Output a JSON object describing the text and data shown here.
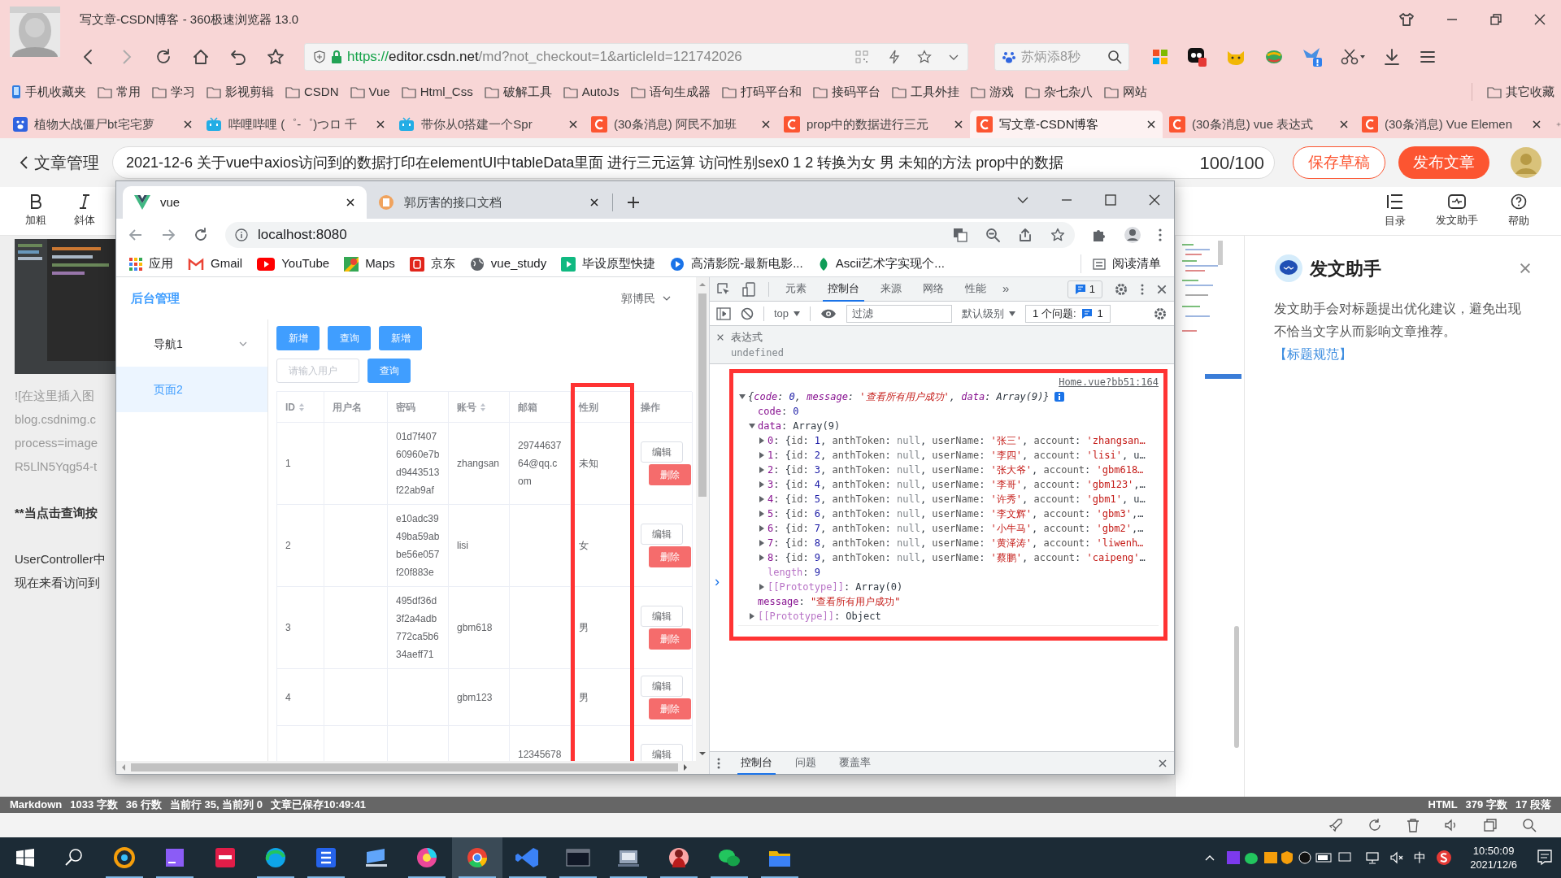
{
  "browser": {
    "title": "写文章-CSDN博客 - 360极速浏览器 13.0",
    "url": {
      "scheme": "https://",
      "host": "editor.csdn.net",
      "path": "/md?not_checkout=1&articleId=121742026"
    },
    "search": "苏炳添8秒",
    "bookmarks": [
      {
        "label": "手机收藏夹",
        "kind": "phone"
      },
      {
        "label": "常用",
        "kind": "folder"
      },
      {
        "label": "学习",
        "kind": "folder"
      },
      {
        "label": "影视剪辑",
        "kind": "folder"
      },
      {
        "label": "CSDN",
        "kind": "folder"
      },
      {
        "label": "Vue",
        "kind": "folder"
      },
      {
        "label": "Html_Css",
        "kind": "folder"
      },
      {
        "label": "破解工具",
        "kind": "folder"
      },
      {
        "label": "AutoJs",
        "kind": "folder"
      },
      {
        "label": "语句生成器",
        "kind": "folder"
      },
      {
        "label": "打码平台和",
        "kind": "folder"
      },
      {
        "label": "接码平台",
        "kind": "folder"
      },
      {
        "label": "工具外挂",
        "kind": "folder"
      },
      {
        "label": "游戏",
        "kind": "folder"
      },
      {
        "label": "杂七杂八",
        "kind": "folder"
      },
      {
        "label": "网站",
        "kind": "folder"
      }
    ],
    "other_bookmarks": "其它收藏",
    "tabs": [
      {
        "label": "植物大战僵尸bt宅宅萝",
        "kind": "baidu",
        "selected": false
      },
      {
        "label": "哔哩哔哩 (゜-゜)つロ 千",
        "kind": "bilibili",
        "selected": false
      },
      {
        "label": "带你从0搭建一个Spr",
        "kind": "bilibili",
        "selected": false
      },
      {
        "label": "(30条消息) 阿民不加班",
        "kind": "csdn",
        "selected": false
      },
      {
        "label": "prop中的数据进行三元",
        "kind": "csdn",
        "selected": false
      },
      {
        "label": "写文章-CSDN博客",
        "kind": "csdn",
        "selected": true
      },
      {
        "label": "(30条消息) vue 表达式",
        "kind": "csdn",
        "selected": false
      },
      {
        "label": "(30条消息) Vue Elemen",
        "kind": "csdn",
        "selected": false
      }
    ]
  },
  "editor": {
    "back": "文章管理",
    "title": "2021-12-6 关于vue中axios访问到的数据打印在elementUI中tableData里面 进行三元运算 访问性别sex0 1 2 转换为女 男 未知的方法  prop中的数据",
    "counter": "100/100",
    "save": "保存草稿",
    "publish": "发布文章",
    "tools_left": [
      {
        "kind": "bold",
        "label": "加粗"
      },
      {
        "kind": "italic",
        "label": "斜体"
      }
    ],
    "tools_right": [
      {
        "kind": "toc",
        "label": "目录"
      },
      {
        "kind": "assistant",
        "label": "发文助手"
      },
      {
        "kind": "help",
        "label": "帮助"
      }
    ],
    "paragraphs": [
      {
        "kind": "image-link",
        "lines": [
          "![在这里插入图",
          "blog.csdnimg.c",
          "process=image",
          "R5LlN5Yqg54-t"
        ]
      },
      {
        "kind": "bold",
        "lines": [
          "**当点击查询按"
        ]
      },
      {
        "kind": "text",
        "lines": [
          "UserController中",
          "现在来看访问到"
        ]
      }
    ]
  },
  "assistant": {
    "title": "发文助手",
    "text": "发文助手会对标题提出优化建议，避免出现不恰当文字从而影响文章推荐。",
    "link": "【标题规范】"
  },
  "status_bar": {
    "left": [
      "Markdown",
      "1033 字数",
      "36 行数",
      "当前行 35, 当前列 0",
      "文章已保存10:49:41"
    ],
    "right": [
      "HTML",
      "379 字数",
      "17 段落"
    ]
  },
  "chrome": {
    "tabs": [
      {
        "label": "vue",
        "kind": "vue",
        "selected": true
      },
      {
        "label": "郭厉害的接口文档",
        "kind": "doc",
        "selected": false
      }
    ],
    "url": "localhost:8080",
    "bookmarks": [
      {
        "label": "应用",
        "kind": "apps"
      },
      {
        "label": "Gmail",
        "kind": "gmail"
      },
      {
        "label": "YouTube",
        "kind": "youtube"
      },
      {
        "label": "Maps",
        "kind": "maps"
      },
      {
        "label": "京东",
        "kind": "jd"
      },
      {
        "label": "vue_study",
        "kind": "globe"
      },
      {
        "label": "毕设原型快捷",
        "kind": "play"
      },
      {
        "label": "高清影院-最新电影...",
        "kind": "movie"
      },
      {
        "label": "Ascii艺术字实现个...",
        "kind": "leaf"
      }
    ],
    "reading_list": "阅读清单"
  },
  "page": {
    "brand": "后台管理",
    "user": "郭博民",
    "nav": [
      {
        "label": "导航1",
        "kind": "group",
        "expanded": false,
        "selected": false
      },
      {
        "label": "页面2",
        "kind": "item",
        "selected": true
      }
    ],
    "buttons": [
      "新增",
      "查询",
      "新增"
    ],
    "search": {
      "placeholder": "请输入用户",
      "button": "查询"
    },
    "table": {
      "columns": [
        {
          "label": "ID",
          "sortable": true
        },
        {
          "label": "用户名",
          "sortable": false
        },
        {
          "label": "密码",
          "sortable": false
        },
        {
          "label": "账号",
          "sortable": true
        },
        {
          "label": "邮箱",
          "sortable": false
        },
        {
          "label": "性别",
          "sortable": false,
          "highlighted": true
        },
        {
          "label": "操作",
          "sortable": false
        }
      ],
      "rows": [
        {
          "id": "1",
          "password": "01d7f40760960e7bd9443513f22ab9af",
          "account": "zhangsan",
          "email": "2974463764@qq.com",
          "gender": "未知",
          "edit": "编辑",
          "delete": "删除"
        },
        {
          "id": "2",
          "password": "e10adc3949ba59abbe56e057f20f883e",
          "account": "lisi",
          "gender": "女",
          "edit": "编辑",
          "delete": "删除"
        },
        {
          "id": "3",
          "password": "495df36d3f2a4adb772ca5b634aeff71",
          "account": "gbm618",
          "gender": "男",
          "edit": "编辑",
          "delete": "删除"
        },
        {
          "id": "4",
          "account": "gbm123",
          "gender": "男",
          "edit": "编辑",
          "delete": "删除"
        },
        {
          "email": "12345678",
          "edit": "编辑"
        }
      ]
    }
  },
  "devtools": {
    "tabs": [
      {
        "label": "元素",
        "selected": false
      },
      {
        "label": "控制台",
        "selected": true
      },
      {
        "label": "来源",
        "selected": false
      },
      {
        "label": "网络",
        "selected": false
      },
      {
        "label": "性能",
        "selected": false
      }
    ],
    "more": "»",
    "badge": "1",
    "context": "top",
    "filter_placeholder": "过滤",
    "level": "默认级别",
    "issues_label": "1 个问题:",
    "issues_count": "1",
    "expression": {
      "label": "表达式",
      "value": "undefined"
    },
    "console": {
      "highlighted": true,
      "source": "Home.vue?bb51:164",
      "prompt": "›",
      "tree": [
        {
          "segs": [
            {
              "kind": "p",
              "text": "{"
            },
            {
              "kind": "k",
              "text": "code"
            },
            {
              "kind": "p",
              "text": ": "
            },
            {
              "kind": "n",
              "text": "0"
            },
            {
              "kind": "p",
              "text": ", "
            },
            {
              "kind": "k",
              "text": "message"
            },
            {
              "kind": "p",
              "text": ": "
            },
            {
              "kind": "s",
              "text": "'查看所有用户成功'"
            },
            {
              "kind": "p",
              "text": ", "
            },
            {
              "kind": "k",
              "text": "data"
            },
            {
              "kind": "p",
              "text": ": Array(9)}"
            }
          ],
          "expanded": true,
          "children": [
            {
              "segs": [
                {
                  "kind": "k",
                  "text": "code"
                },
                {
                  "kind": "p",
                  "text": ": "
                },
                {
                  "kind": "n",
                  "text": "0"
                }
              ]
            },
            {
              "segs": [
                {
                  "kind": "k",
                  "text": "data"
                },
                {
                  "kind": "p",
                  "text": ": Array(9)"
                }
              ],
              "expanded": true,
              "children": [
                {
                  "segs": [
                    {
                      "kind": "k",
                      "text": "0"
                    },
                    {
                      "kind": "p",
                      "text": ": {"
                    },
                    {
                      "kind": "pk",
                      "text": "id"
                    },
                    {
                      "kind": "p",
                      "text": ": "
                    },
                    {
                      "kind": "n",
                      "text": "1"
                    },
                    {
                      "kind": "p",
                      "text": ", "
                    },
                    {
                      "kind": "pk",
                      "text": "anthToken"
                    },
                    {
                      "kind": "p",
                      "text": ": "
                    },
                    {
                      "kind": "nl",
                      "text": "null"
                    },
                    {
                      "kind": "p",
                      "text": ", "
                    },
                    {
                      "kind": "pk",
                      "text": "userName"
                    },
                    {
                      "kind": "p",
                      "text": ": "
                    },
                    {
                      "kind": "s",
                      "text": "'张三'"
                    },
                    {
                      "kind": "p",
                      "text": ", "
                    },
                    {
                      "kind": "pk",
                      "text": "account"
                    },
                    {
                      "kind": "p",
                      "text": ": "
                    },
                    {
                      "kind": "s",
                      "text": "'zhangsan…"
                    }
                  ],
                  "expanded": false
                },
                {
                  "segs": [
                    {
                      "kind": "k",
                      "text": "1"
                    },
                    {
                      "kind": "p",
                      "text": ": {"
                    },
                    {
                      "kind": "pk",
                      "text": "id"
                    },
                    {
                      "kind": "p",
                      "text": ": "
                    },
                    {
                      "kind": "n",
                      "text": "2"
                    },
                    {
                      "kind": "p",
                      "text": ", "
                    },
                    {
                      "kind": "pk",
                      "text": "anthToken"
                    },
                    {
                      "kind": "p",
                      "text": ": "
                    },
                    {
                      "kind": "nl",
                      "text": "null"
                    },
                    {
                      "kind": "p",
                      "text": ", "
                    },
                    {
                      "kind": "pk",
                      "text": "userName"
                    },
                    {
                      "kind": "p",
                      "text": ": "
                    },
                    {
                      "kind": "s",
                      "text": "'李四'"
                    },
                    {
                      "kind": "p",
                      "text": ", "
                    },
                    {
                      "kind": "pk",
                      "text": "account"
                    },
                    {
                      "kind": "p",
                      "text": ": "
                    },
                    {
                      "kind": "s",
                      "text": "'lisi'"
                    },
                    {
                      "kind": "p",
                      "text": ", u…"
                    }
                  ],
                  "expanded": false
                },
                {
                  "segs": [
                    {
                      "kind": "k",
                      "text": "2"
                    },
                    {
                      "kind": "p",
                      "text": ": {"
                    },
                    {
                      "kind": "pk",
                      "text": "id"
                    },
                    {
                      "kind": "p",
                      "text": ": "
                    },
                    {
                      "kind": "n",
                      "text": "3"
                    },
                    {
                      "kind": "p",
                      "text": ", "
                    },
                    {
                      "kind": "pk",
                      "text": "anthToken"
                    },
                    {
                      "kind": "p",
                      "text": ": "
                    },
                    {
                      "kind": "nl",
                      "text": "null"
                    },
                    {
                      "kind": "p",
                      "text": ", "
                    },
                    {
                      "kind": "pk",
                      "text": "userName"
                    },
                    {
                      "kind": "p",
                      "text": ": "
                    },
                    {
                      "kind": "s",
                      "text": "'张大爷'"
                    },
                    {
                      "kind": "p",
                      "text": ", "
                    },
                    {
                      "kind": "pk",
                      "text": "account"
                    },
                    {
                      "kind": "p",
                      "text": ": "
                    },
                    {
                      "kind": "s",
                      "text": "'gbm618…"
                    }
                  ],
                  "expanded": false
                },
                {
                  "segs": [
                    {
                      "kind": "k",
                      "text": "3"
                    },
                    {
                      "kind": "p",
                      "text": ": {"
                    },
                    {
                      "kind": "pk",
                      "text": "id"
                    },
                    {
                      "kind": "p",
                      "text": ": "
                    },
                    {
                      "kind": "n",
                      "text": "4"
                    },
                    {
                      "kind": "p",
                      "text": ", "
                    },
                    {
                      "kind": "pk",
                      "text": "anthToken"
                    },
                    {
                      "kind": "p",
                      "text": ": "
                    },
                    {
                      "kind": "nl",
                      "text": "null"
                    },
                    {
                      "kind": "p",
                      "text": ", "
                    },
                    {
                      "kind": "pk",
                      "text": "userName"
                    },
                    {
                      "kind": "p",
                      "text": ": "
                    },
                    {
                      "kind": "s",
                      "text": "'李哥'"
                    },
                    {
                      "kind": "p",
                      "text": ", "
                    },
                    {
                      "kind": "pk",
                      "text": "account"
                    },
                    {
                      "kind": "p",
                      "text": ": "
                    },
                    {
                      "kind": "s",
                      "text": "'gbm123'"
                    },
                    {
                      "kind": "p",
                      "text": ",…"
                    }
                  ],
                  "expanded": false
                },
                {
                  "segs": [
                    {
                      "kind": "k",
                      "text": "4"
                    },
                    {
                      "kind": "p",
                      "text": ": {"
                    },
                    {
                      "kind": "pk",
                      "text": "id"
                    },
                    {
                      "kind": "p",
                      "text": ": "
                    },
                    {
                      "kind": "n",
                      "text": "5"
                    },
                    {
                      "kind": "p",
                      "text": ", "
                    },
                    {
                      "kind": "pk",
                      "text": "anthToken"
                    },
                    {
                      "kind": "p",
                      "text": ": "
                    },
                    {
                      "kind": "nl",
                      "text": "null"
                    },
                    {
                      "kind": "p",
                      "text": ", "
                    },
                    {
                      "kind": "pk",
                      "text": "userName"
                    },
                    {
                      "kind": "p",
                      "text": ": "
                    },
                    {
                      "kind": "s",
                      "text": "'许秀'"
                    },
                    {
                      "kind": "p",
                      "text": ", "
                    },
                    {
                      "kind": "pk",
                      "text": "account"
                    },
                    {
                      "kind": "p",
                      "text": ": "
                    },
                    {
                      "kind": "s",
                      "text": "'gbm1'"
                    },
                    {
                      "kind": "p",
                      "text": ", u…"
                    }
                  ],
                  "expanded": false
                },
                {
                  "segs": [
                    {
                      "kind": "k",
                      "text": "5"
                    },
                    {
                      "kind": "p",
                      "text": ": {"
                    },
                    {
                      "kind": "pk",
                      "text": "id"
                    },
                    {
                      "kind": "p",
                      "text": ": "
                    },
                    {
                      "kind": "n",
                      "text": "6"
                    },
                    {
                      "kind": "p",
                      "text": ", "
                    },
                    {
                      "kind": "pk",
                      "text": "anthToken"
                    },
                    {
                      "kind": "p",
                      "text": ": "
                    },
                    {
                      "kind": "nl",
                      "text": "null"
                    },
                    {
                      "kind": "p",
                      "text": ", "
                    },
                    {
                      "kind": "pk",
                      "text": "userName"
                    },
                    {
                      "kind": "p",
                      "text": ": "
                    },
                    {
                      "kind": "s",
                      "text": "'李文辉'"
                    },
                    {
                      "kind": "p",
                      "text": ", "
                    },
                    {
                      "kind": "pk",
                      "text": "account"
                    },
                    {
                      "kind": "p",
                      "text": ": "
                    },
                    {
                      "kind": "s",
                      "text": "'gbm3'"
                    },
                    {
                      "kind": "p",
                      "text": ",…"
                    }
                  ],
                  "expanded": false
                },
                {
                  "segs": [
                    {
                      "kind": "k",
                      "text": "6"
                    },
                    {
                      "kind": "p",
                      "text": ": {"
                    },
                    {
                      "kind": "pk",
                      "text": "id"
                    },
                    {
                      "kind": "p",
                      "text": ": "
                    },
                    {
                      "kind": "n",
                      "text": "7"
                    },
                    {
                      "kind": "p",
                      "text": ", "
                    },
                    {
                      "kind": "pk",
                      "text": "anthToken"
                    },
                    {
                      "kind": "p",
                      "text": ": "
                    },
                    {
                      "kind": "nl",
                      "text": "null"
                    },
                    {
                      "kind": "p",
                      "text": ", "
                    },
                    {
                      "kind": "pk",
                      "text": "userName"
                    },
                    {
                      "kind": "p",
                      "text": ": "
                    },
                    {
                      "kind": "s",
                      "text": "'小牛马'"
                    },
                    {
                      "kind": "p",
                      "text": ", "
                    },
                    {
                      "kind": "pk",
                      "text": "account"
                    },
                    {
                      "kind": "p",
                      "text": ": "
                    },
                    {
                      "kind": "s",
                      "text": "'gbm2'"
                    },
                    {
                      "kind": "p",
                      "text": ",…"
                    }
                  ],
                  "expanded": false
                },
                {
                  "segs": [
                    {
                      "kind": "k",
                      "text": "7"
                    },
                    {
                      "kind": "p",
                      "text": ": {"
                    },
                    {
                      "kind": "pk",
                      "text": "id"
                    },
                    {
                      "kind": "p",
                      "text": ": "
                    },
                    {
                      "kind": "n",
                      "text": "8"
                    },
                    {
                      "kind": "p",
                      "text": ", "
                    },
                    {
                      "kind": "pk",
                      "text": "anthToken"
                    },
                    {
                      "kind": "p",
                      "text": ": "
                    },
                    {
                      "kind": "nl",
                      "text": "null"
                    },
                    {
                      "kind": "p",
                      "text": ", "
                    },
                    {
                      "kind": "pk",
                      "text": "userName"
                    },
                    {
                      "kind": "p",
                      "text": ": "
                    },
                    {
                      "kind": "s",
                      "text": "'黄泽涛'"
                    },
                    {
                      "kind": "p",
                      "text": ", "
                    },
                    {
                      "kind": "pk",
                      "text": "account"
                    },
                    {
                      "kind": "p",
                      "text": ": "
                    },
                    {
                      "kind": "s",
                      "text": "'liwenh…"
                    }
                  ],
                  "expanded": false
                },
                {
                  "segs": [
                    {
                      "kind": "k",
                      "text": "8"
                    },
                    {
                      "kind": "p",
                      "text": ": {"
                    },
                    {
                      "kind": "pk",
                      "text": "id"
                    },
                    {
                      "kind": "p",
                      "text": ": "
                    },
                    {
                      "kind": "n",
                      "text": "9"
                    },
                    {
                      "kind": "p",
                      "text": ", "
                    },
                    {
                      "kind": "pk",
                      "text": "anthToken"
                    },
                    {
                      "kind": "p",
                      "text": ": "
                    },
                    {
                      "kind": "nl",
                      "text": "null"
                    },
                    {
                      "kind": "p",
                      "text": ", "
                    },
                    {
                      "kind": "pk",
                      "text": "userName"
                    },
                    {
                      "kind": "p",
                      "text": ": "
                    },
                    {
                      "kind": "s",
                      "text": "'蔡鹏'"
                    },
                    {
                      "kind": "p",
                      "text": ", "
                    },
                    {
                      "kind": "pk",
                      "text": "account"
                    },
                    {
                      "kind": "p",
                      "text": ": "
                    },
                    {
                      "kind": "s",
                      "text": "'caipeng'"
                    },
                    {
                      "kind": "p",
                      "text": "…"
                    }
                  ],
                  "expanded": false
                },
                {
                  "segs": [
                    {
                      "kind": "lk",
                      "text": "length"
                    },
                    {
                      "kind": "p",
                      "text": ": "
                    },
                    {
                      "kind": "n",
                      "text": "9"
                    }
                  ]
                },
                {
                  "segs": [
                    {
                      "kind": "lk",
                      "text": "[[Prototype]]"
                    },
                    {
                      "kind": "p",
                      "text": ": Array(0)"
                    }
                  ],
                  "expanded": false
                }
              ]
            },
            {
              "segs": [
                {
                  "kind": "k",
                  "text": "message"
                },
                {
                  "kind": "p",
                  "text": ": "
                },
                {
                  "kind": "s",
                  "text": "\"查看所有用户成功\""
                }
              ]
            },
            {
              "segs": [
                {
                  "kind": "lk",
                  "text": "[[Prototype]]"
                },
                {
                  "kind": "p",
                  "text": ": Object"
                }
              ],
              "expanded": false
            }
          ]
        }
      ]
    },
    "drawer_tabs": [
      {
        "label": "控制台",
        "selected": true
      },
      {
        "label": "问题",
        "selected": false
      },
      {
        "label": "覆盖率",
        "selected": false
      }
    ]
  },
  "taskbar": {
    "apps": [
      {
        "running": true,
        "selected": false
      },
      {
        "running": true,
        "selected": false
      },
      {
        "running": false,
        "selected": false
      },
      {
        "running": true,
        "selected": false
      },
      {
        "running": true,
        "selected": false
      },
      {
        "running": false,
        "selected": false
      },
      {
        "running": true,
        "selected": false
      },
      {
        "running": true,
        "selected": true
      },
      {
        "running": true,
        "selected": false
      },
      {
        "running": true,
        "selected": false
      },
      {
        "running": true,
        "selected": false
      },
      {
        "running": true,
        "selected": false
      },
      {
        "running": true,
        "selected": false
      },
      {
        "running": true,
        "selected": false
      }
    ],
    "ime": "中",
    "time": "10:50:09",
    "date": "2021/12/6"
  }
}
